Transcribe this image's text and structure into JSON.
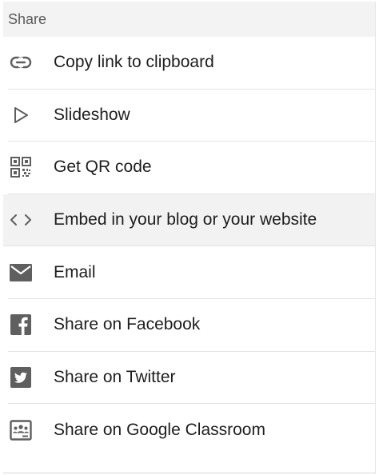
{
  "header": {
    "title": "Share"
  },
  "items": [
    {
      "label": "Copy link to clipboard",
      "icon": "link-icon"
    },
    {
      "label": "Slideshow",
      "icon": "play-icon"
    },
    {
      "label": "Get QR code",
      "icon": "qr-code-icon"
    },
    {
      "label": "Embed in your blog or your website",
      "icon": "code-icon",
      "highlighted": true
    },
    {
      "label": "Email",
      "icon": "email-icon"
    },
    {
      "label": "Share on Facebook",
      "icon": "facebook-icon"
    },
    {
      "label": "Share on Twitter",
      "icon": "twitter-icon"
    },
    {
      "label": "Share on Google Classroom",
      "icon": "google-classroom-icon"
    }
  ],
  "colors": {
    "icon": "#5f5f5f",
    "text": "#1e1e1e",
    "header_bg": "#f3f3f3",
    "highlight_bg": "#f2f2f2"
  }
}
